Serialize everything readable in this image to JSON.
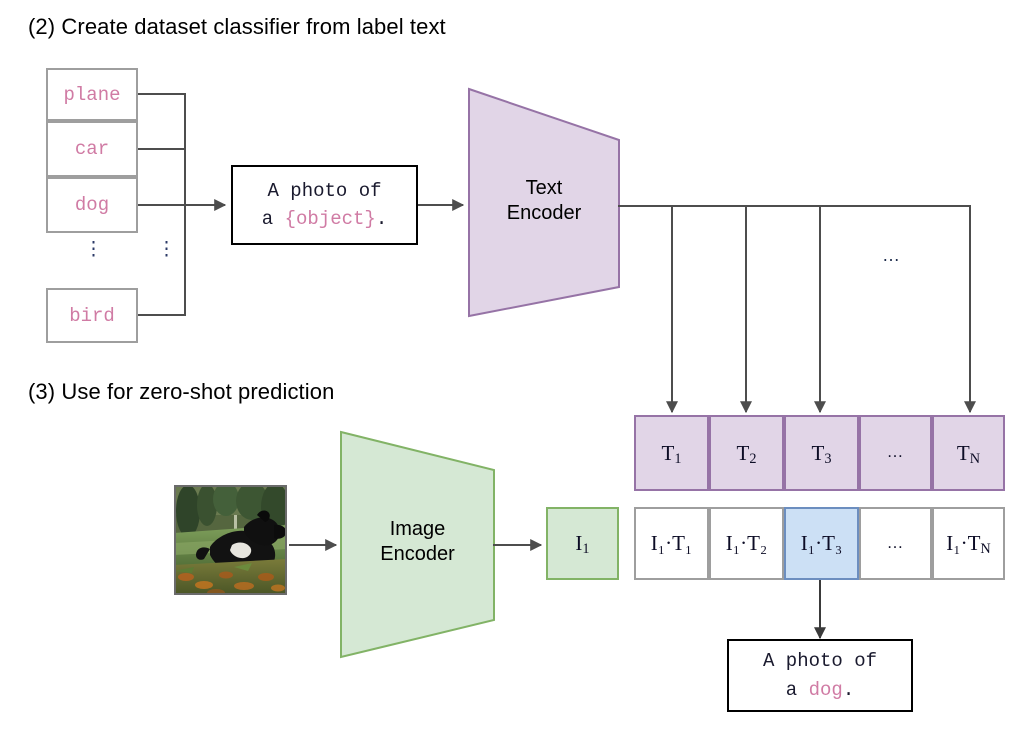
{
  "figure": {
    "sections": [
      {
        "id": "section-2",
        "label": "(2) Create dataset classifier from label text"
      },
      {
        "id": "section-3",
        "label": "(3) Use for zero-shot prediction"
      }
    ]
  },
  "label_list": {
    "items": [
      {
        "text": "plane"
      },
      {
        "text": "car"
      },
      {
        "text": "dog"
      },
      {
        "text": "bird"
      }
    ],
    "ellipsis": "⋮"
  },
  "prompt_template": {
    "line1": "A photo of",
    "line2_prefix": "a ",
    "line2_slot": "{object}",
    "line2_suffix": "."
  },
  "prompt_result": {
    "line1": "A photo of",
    "line2_prefix": "a ",
    "line2_slot": "dog",
    "line2_suffix": "."
  },
  "encoders": {
    "text": {
      "line1": "Text",
      "line2": "Encoder"
    },
    "image": {
      "line1": "Image",
      "line2": "Encoder"
    }
  },
  "text_embeddings": {
    "cells": [
      {
        "base": "T",
        "sub": "1"
      },
      {
        "base": "T",
        "sub": "2"
      },
      {
        "base": "T",
        "sub": "3"
      },
      {
        "base": "…",
        "sub": ""
      },
      {
        "base": "T",
        "sub": "N"
      }
    ]
  },
  "image_embedding": {
    "base": "I",
    "sub": "1"
  },
  "similarity_row": {
    "cells": [
      {
        "text": "I₁·T₁",
        "highlighted": false
      },
      {
        "text": "I₁·T₂",
        "highlighted": false
      },
      {
        "text": "I₁·T₃",
        "highlighted": true
      },
      {
        "text": "…",
        "highlighted": false
      },
      {
        "text": "I₁·T",
        "highlighted": false
      }
    ]
  },
  "wire_ellipsis": "…",
  "photo": {
    "alt": "black dog standing in grass with autumn leaves"
  },
  "colors": {
    "purple_fill": "#e1d5e7",
    "purple_stroke": "#9673a6",
    "green_fill": "#d5e8d4",
    "green_stroke": "#82b366",
    "blue_fill": "#cce0f5",
    "blue_stroke": "#6c8ebf",
    "pink_text": "#d07ba4",
    "gray_stroke": "#9e9e9e",
    "wire": "#4d4d4d"
  }
}
